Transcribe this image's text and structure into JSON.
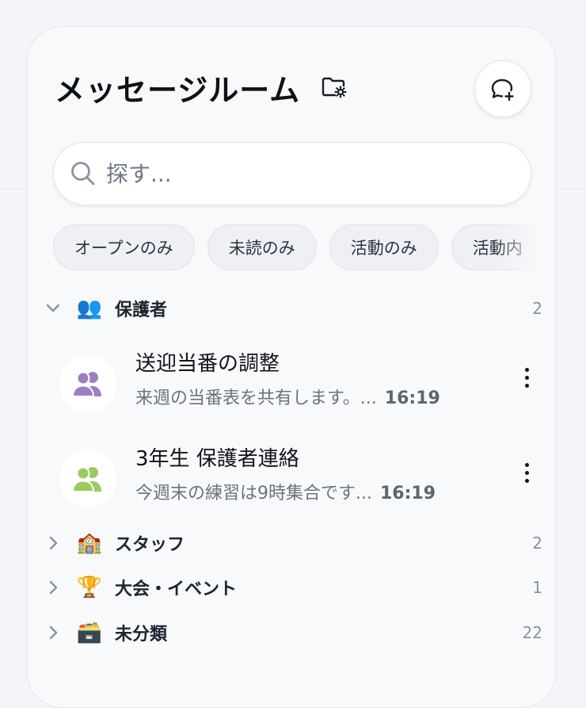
{
  "header": {
    "title": "メッセージルーム",
    "folder_icon": "folder-settings-icon",
    "new_chat_icon": "chat-plus-icon"
  },
  "search": {
    "placeholder": "探す..."
  },
  "filters": [
    {
      "label": "オープンのみ"
    },
    {
      "label": "未読のみ"
    },
    {
      "label": "活動のみ"
    },
    {
      "label": "活動内"
    }
  ],
  "groups": [
    {
      "name": "保護者",
      "emoji": "👥",
      "count": "2",
      "expanded": true,
      "rooms": [
        {
          "name": "送迎当番の調整",
          "preview": "来週の当番表を共有します。...",
          "time": "16:19",
          "avatar_color": "#9b7fc3"
        },
        {
          "name": "3年生 保護者連絡",
          "preview": "今週末の練習は9時集合です...",
          "time": "16:19",
          "avatar_color": "#9acb5f"
        }
      ]
    },
    {
      "name": "スタッフ",
      "emoji": "🏫",
      "count": "2",
      "expanded": false
    },
    {
      "name": "大会・イベント",
      "emoji": "🏆",
      "count": "1",
      "expanded": false
    },
    {
      "name": "未分類",
      "emoji": "🗃️",
      "count": "22",
      "expanded": false
    }
  ],
  "colors": {
    "panel_bg": "#f8f9fb",
    "chip_bg": "#eef0f3",
    "muted_text": "#6b7380"
  }
}
